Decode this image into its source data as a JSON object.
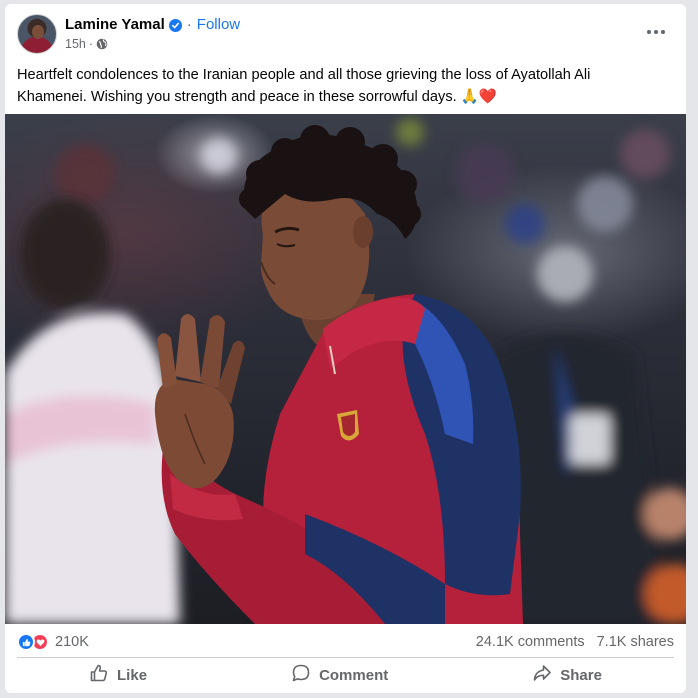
{
  "post": {
    "author": "Lamine Yamal",
    "follow_label": "Follow",
    "separator": "·",
    "time": "15h",
    "caption": "Heartfelt condolences to the Iranian people and all those grieving the loss of Ayatollah Ali Khamenei. Wishing you strength and peace in these sorrowful days. 🙏❤️"
  },
  "reactions": {
    "count": "210K",
    "icons": [
      "like-icon",
      "love-icon"
    ],
    "comments": "24.1K comments",
    "shares": "7.1K shares"
  },
  "actions": {
    "like": "Like",
    "comment": "Comment",
    "share": "Share"
  },
  "colors": {
    "accent": "#1877f2",
    "love": "#f33e58",
    "muted_text": "#65676b",
    "jacket_red": "#b5203a",
    "jacket_navy": "#1f3266"
  }
}
